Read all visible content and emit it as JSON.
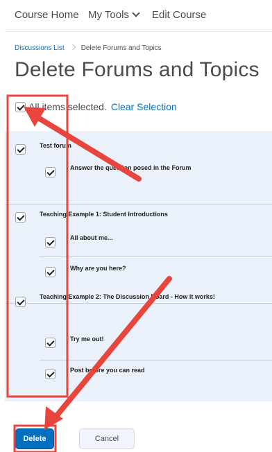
{
  "nav": {
    "items": [
      "Course Home",
      "My Tools",
      "Edit Course"
    ]
  },
  "breadcrumb": {
    "link": "Discussions List",
    "current": "Delete Forums and Topics"
  },
  "page": {
    "title": "Delete Forums and Topics"
  },
  "selection": {
    "status": "All items selected.",
    "clear_label": "Clear Selection"
  },
  "forums": [
    {
      "label": "Test forum",
      "topics": [
        "Answer the question posed in the Forum"
      ]
    },
    {
      "label": "Teaching Example 1: Student Introductions",
      "topics": [
        "All about me...",
        "Why are you here?"
      ]
    },
    {
      "label": "Teaching Example 2: The Discussion Board - How it works!",
      "topics": [
        "Try me out!",
        "Post before you can read"
      ]
    }
  ],
  "actions": {
    "delete_label": "Delete",
    "cancel_label": "Cancel"
  },
  "colors": {
    "link": "#006fbf",
    "primary": "#006fbf",
    "annotation": "#e8453c",
    "panel": "#eaf1fb"
  }
}
